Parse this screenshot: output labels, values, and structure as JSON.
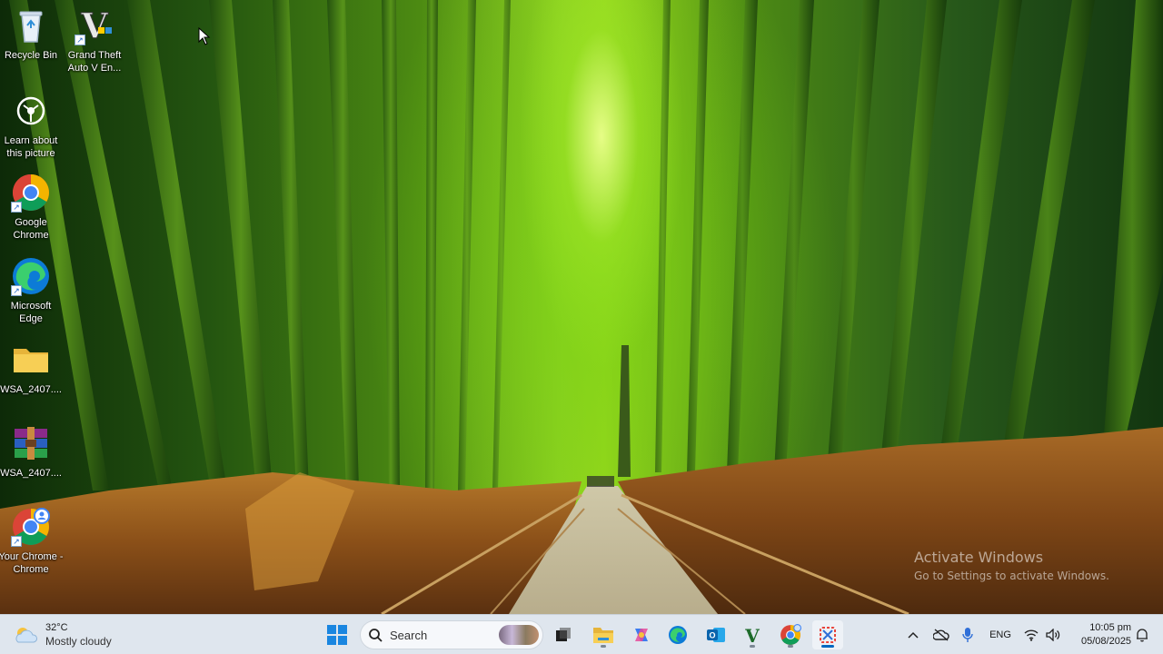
{
  "desktop": {
    "icons": [
      {
        "label": "Recycle Bin",
        "icon": "recycle-bin-icon"
      },
      {
        "label": "Grand Theft Auto V En...",
        "icon": "gta-v-icon"
      },
      {
        "label": "Learn about this picture",
        "icon": "camera-icon"
      },
      {
        "label": "Google Chrome",
        "icon": "chrome-icon"
      },
      {
        "label": "Microsoft Edge",
        "icon": "edge-icon"
      },
      {
        "label": "WSA_2407....",
        "icon": "folder-icon"
      },
      {
        "label": "WSA_2407....",
        "icon": "winrar-archive-icon"
      },
      {
        "label": "Your Chrome - Chrome",
        "icon": "chrome-profile-icon"
      }
    ],
    "watermark": {
      "title": "Activate Windows",
      "subtitle": "Go to Settings to activate Windows."
    }
  },
  "taskbar": {
    "weather": {
      "temp": "32°C",
      "condition": "Mostly cloudy"
    },
    "search_placeholder": "Search",
    "pinned": [
      "windows-start-icon",
      "search-icon",
      "task-view-icon",
      "file-explorer-icon",
      "copilot-icon",
      "edge-icon",
      "outlook-icon",
      "gta-v-icon",
      "chrome-icon",
      "snipping-tool-icon"
    ],
    "tray": {
      "language": "ENG",
      "time": "10:05 pm",
      "date": "05/08/2025"
    }
  },
  "colors": {
    "taskbar_bg": "#dfe6ee",
    "accent_blue": "#0067c0"
  }
}
